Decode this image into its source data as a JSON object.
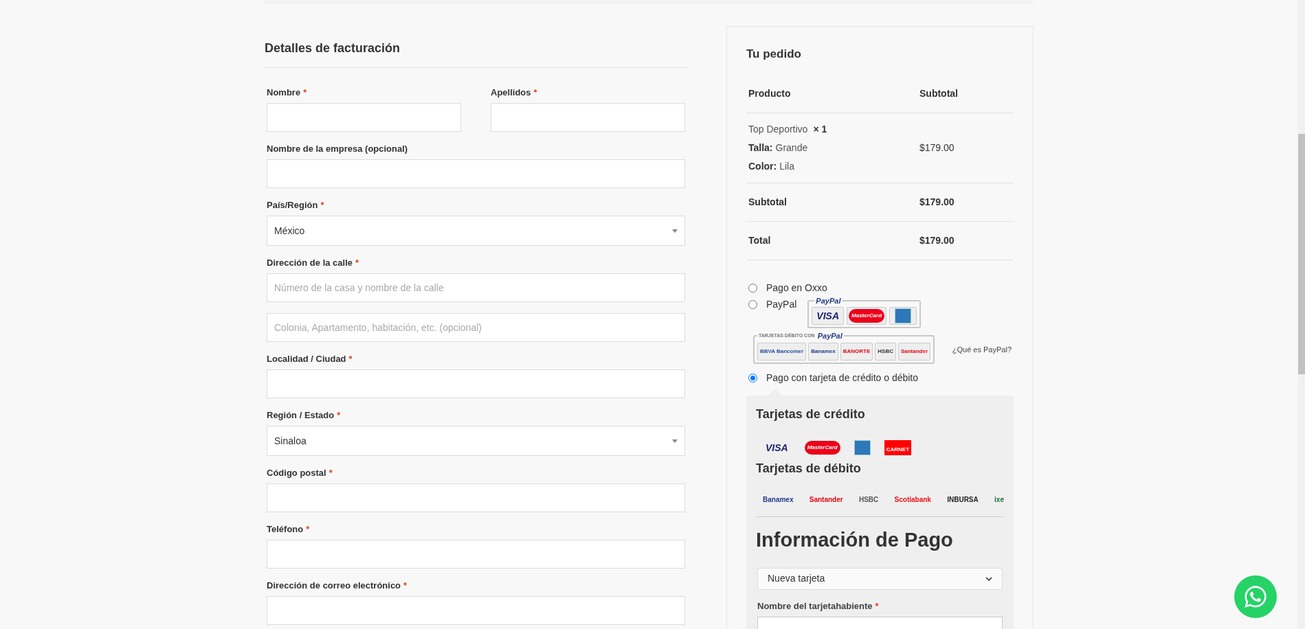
{
  "billing": {
    "title": "Detalles de facturación",
    "rows": [
      {
        "fields": [
          {
            "label": "Nombre",
            "required_mark": "*",
            "kind": "text"
          },
          {
            "label": "Apellidos",
            "required_mark": "*",
            "kind": "text"
          }
        ]
      },
      {
        "fields": [
          {
            "label": "Nombre de la empresa (opcional)",
            "kind": "text"
          }
        ]
      },
      {
        "fields": [
          {
            "label": "País/Región",
            "required_mark": "*",
            "kind": "select",
            "value": "México"
          }
        ]
      },
      {
        "fields": [
          {
            "label": "Dirección de la calle",
            "required_mark": "*",
            "kind": "text",
            "placeholder": "Número de la casa y nombre de la calle"
          }
        ]
      },
      {
        "fields": [
          {
            "kind": "text",
            "placeholder": "Colonia, Apartamento, habitación, etc. (opcional)"
          }
        ]
      },
      {
        "fields": [
          {
            "label": "Localidad / Ciudad",
            "required_mark": "*",
            "kind": "text"
          }
        ]
      },
      {
        "fields": [
          {
            "label": "Región / Estado",
            "required_mark": "*",
            "kind": "select",
            "value": "Sinaloa"
          }
        ]
      },
      {
        "fields": [
          {
            "label": "Código postal",
            "required_mark": "*",
            "kind": "text"
          }
        ]
      },
      {
        "fields": [
          {
            "label": "Teléfono",
            "required_mark": "*",
            "kind": "text"
          }
        ]
      },
      {
        "fields": [
          {
            "label": "Dirección de correo electrónico",
            "required_mark": "*",
            "kind": "text"
          }
        ]
      }
    ]
  },
  "order": {
    "title": "Tu pedido",
    "columns": [
      "Producto",
      "Subtotal"
    ],
    "items": [
      {
        "name": "Top Deportivo",
        "qty": "× 1",
        "attributes": [
          {
            "key": "Talla:",
            "value": "Grande"
          },
          {
            "key": "Color:",
            "value": "Lila"
          }
        ],
        "subtotal": "$179.00"
      }
    ],
    "totals": [
      {
        "label": "Subtotal",
        "value": "$179.00"
      },
      {
        "label": "Total",
        "value": "$179.00"
      }
    ]
  },
  "payment_methods": [
    {
      "kind": "oxxo",
      "label": "Pago en Oxxo",
      "selected": false
    },
    {
      "kind": "paypal",
      "label": "PayPal",
      "selected": false
    },
    {
      "kind": "card",
      "label": "Pago con tarjeta de crédito o débito",
      "selected": true
    }
  ],
  "paypal": {
    "brand": "PayPal",
    "cards": [
      {
        "kind": "visa",
        "label": "VISA"
      },
      {
        "kind": "mastercard",
        "label": "MasterCard"
      },
      {
        "kind": "amex"
      }
    ],
    "debit_title": "TARJETAS DÉBITO CON",
    "debit_brand": "PayPal",
    "banks": [
      {
        "label": "BBVA Bancomer",
        "color": "#1e4e9c"
      },
      {
        "label": "Banamex",
        "color": "#1f3c88"
      },
      {
        "label": "BANORTE",
        "color": "#e30613"
      },
      {
        "label": "HSBC",
        "color": "#333333"
      },
      {
        "label": "Santander",
        "color": "#e30613"
      }
    ],
    "link": "¿Qué es PayPal?"
  },
  "card_box": {
    "credit_title": "Tarjetas de crédito",
    "credit_logos": [
      {
        "kind": "visa",
        "label": "VISA"
      },
      {
        "kind": "mastercard",
        "label": "MasterCard"
      },
      {
        "kind": "amex"
      },
      {
        "kind": "carnet",
        "label": "CARNET"
      }
    ],
    "debit_title": "Tarjetas de débito",
    "debit_logos": [
      {
        "label": "Banamex",
        "color": "#1f3c88"
      },
      {
        "label": "Santander",
        "color": "#e30613"
      },
      {
        "label": "HSBC",
        "color": "#555555"
      },
      {
        "label": "Scotiabank",
        "color": "#ec111a"
      },
      {
        "label": "INBURSA",
        "color": "#222222"
      },
      {
        "label": "ixe",
        "color": "#1c6e3d"
      }
    ],
    "info_title": "Información de Pago",
    "saved_card": "Nueva tarjeta",
    "holder_label": "Nombre del tarjetahabiente",
    "holder_required_mark": "*"
  }
}
